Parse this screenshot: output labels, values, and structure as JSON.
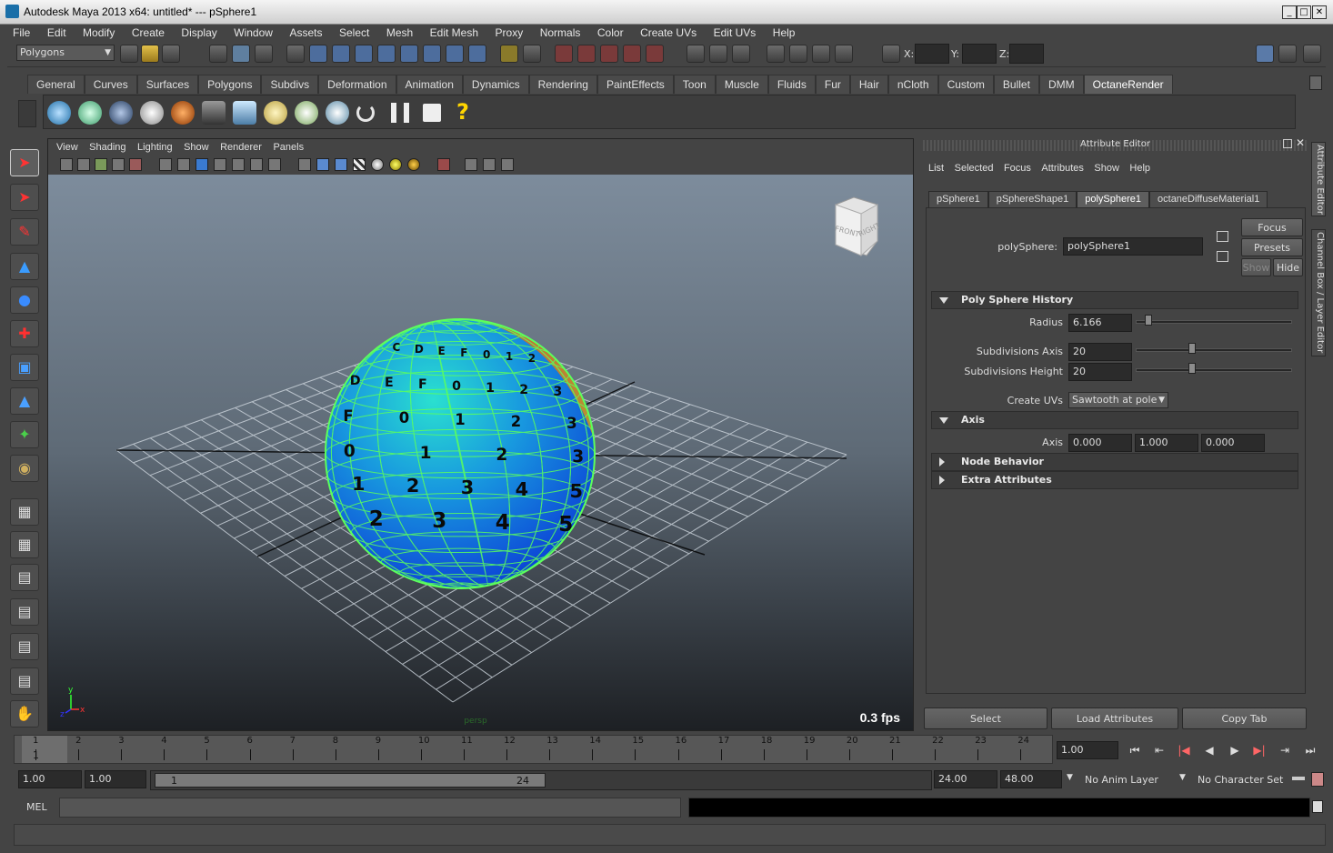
{
  "window": {
    "title": "Autodesk Maya 2013 x64: untitled*   ---   pSphere1"
  },
  "menubar": [
    "File",
    "Edit",
    "Modify",
    "Create",
    "Display",
    "Window",
    "Assets",
    "Select",
    "Mesh",
    "Edit Mesh",
    "Proxy",
    "Normals",
    "Color",
    "Create UVs",
    "Edit UVs",
    "Help"
  ],
  "status": {
    "mode": "Polygons",
    "x_label": "X:",
    "y_label": "Y:",
    "z_label": "Z:"
  },
  "shelf": {
    "tabs": [
      "General",
      "Curves",
      "Surfaces",
      "Polygons",
      "Subdivs",
      "Deformation",
      "Animation",
      "Dynamics",
      "Rendering",
      "PaintEffects",
      "Toon",
      "Muscle",
      "Fluids",
      "Fur",
      "Hair",
      "nCloth",
      "Custom",
      "Bullet",
      "DMM",
      "OctaneRender"
    ],
    "active_tab": "OctaneRender",
    "help_glyph": "?"
  },
  "viewport": {
    "menu": [
      "View",
      "Shading",
      "Lighting",
      "Show",
      "Renderer",
      "Panels"
    ],
    "fps": "0.3 fps",
    "viewcube": {
      "front": "FRONT",
      "right": "RIGHT",
      "top": "TOP"
    },
    "camera_label": "persp",
    "axis": {
      "x": "x",
      "y": "y",
      "z": "z"
    }
  },
  "attribute_editor": {
    "header": "Attribute Editor",
    "menu": [
      "List",
      "Selected",
      "Focus",
      "Attributes",
      "Show",
      "Help"
    ],
    "tabs": [
      "pSphere1",
      "pSphereShape1",
      "polySphere1",
      "octaneDiffuseMaterial1"
    ],
    "active_tab": "polySphere1",
    "node_label": "polySphere:",
    "node_value": "polySphere1",
    "buttons": {
      "focus": "Focus",
      "presets": "Presets",
      "show": "Show",
      "hide": "Hide"
    },
    "sections": {
      "history": "Poly Sphere History",
      "axis": "Axis",
      "node_behavior": "Node Behavior",
      "extra": "Extra Attributes"
    },
    "fields": {
      "radius_label": "Radius",
      "radius": "6.166",
      "subdiv_axis_label": "Subdivisions Axis",
      "subdiv_axis": "20",
      "subdiv_height_label": "Subdivisions Height",
      "subdiv_height": "20",
      "create_uvs_label": "Create UVs",
      "create_uvs": "Sawtooth at pole",
      "axis_label": "Axis",
      "axis_x": "0.000",
      "axis_y": "1.000",
      "axis_z": "0.000"
    },
    "slider_levels": {
      "radius": 0.08,
      "subdiv_axis": 0.36,
      "subdiv_height": 0.36
    },
    "bottom_buttons": [
      "Select",
      "Load Attributes",
      "Copy Tab"
    ]
  },
  "side_tabs": [
    "Attribute Editor",
    "Channel Box / Layer Editor"
  ],
  "timeline": {
    "ticks": [
      "1",
      "2",
      "3",
      "4",
      "5",
      "6",
      "7",
      "8",
      "9",
      "10",
      "11",
      "12",
      "13",
      "14",
      "15",
      "16",
      "17",
      "18",
      "19",
      "20",
      "21",
      "22",
      "23",
      "24"
    ],
    "current_frame": "1",
    "current_field": "1.00",
    "controls": [
      "⏮",
      "⇤",
      "|◀",
      "◀",
      "▶",
      "▶|",
      "⇥",
      "⏭"
    ]
  },
  "range": {
    "start": "1.00",
    "playback_start": "1.00",
    "slider_start": "1",
    "slider_end": "24",
    "playback_end": "24.00",
    "end": "48.00",
    "anim_layer": "No Anim Layer",
    "character_set": "No Character Set"
  },
  "command_line": {
    "label": "MEL"
  },
  "sphere_labels": {
    "row1": [
      "2",
      "C",
      "D",
      "E",
      "F",
      "0",
      "1",
      "2"
    ],
    "row2": [
      "D",
      "E",
      "F",
      "0",
      "1",
      "2",
      "3"
    ],
    "row3": [
      "F",
      "0",
      "1",
      "2",
      "3"
    ],
    "row4": [
      "0",
      "1",
      "2",
      "3"
    ],
    "row5": [
      "1",
      "2",
      "3",
      "4",
      "5"
    ],
    "row6": [
      "2",
      "3",
      "4",
      "5"
    ]
  },
  "colors": {
    "accent_active": "#5e5e5e",
    "sphere_top": "#16c0c0",
    "sphere_bottom": "#0b3fd6",
    "wireframe": "#5cff5c"
  }
}
